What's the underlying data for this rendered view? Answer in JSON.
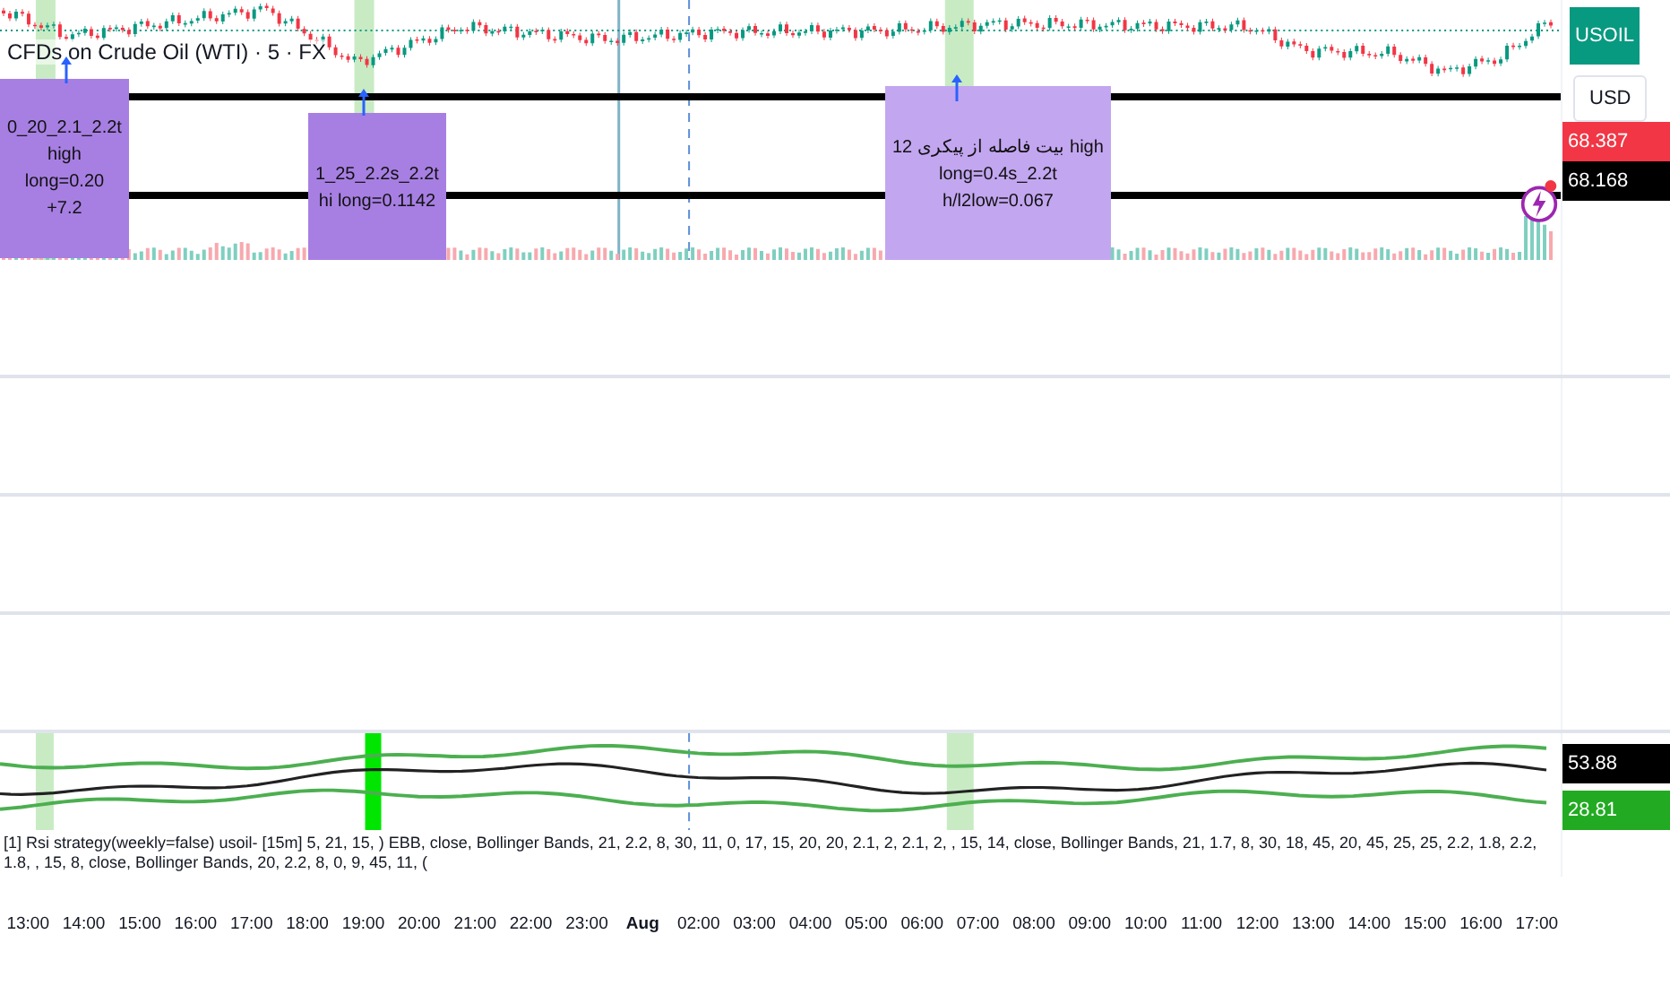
{
  "symbol_title": "CFDs on Crude Oil (WTI) · 5 · FX",
  "signal_labels": [
    {
      "lines": [
        "0_20_2.1_2.2t",
        "high",
        "long=0.20",
        "+7.2"
      ]
    },
    {
      "lines": [
        "1_25_2.2s_2.2t",
        "hi long=0.1142"
      ]
    },
    {
      "lines": [
        "بیت فاصله از پیکری 12 high",
        "long=0.4s_2.2t",
        "h/l2low=0.067"
      ]
    }
  ],
  "price_axis": {
    "symbol_tag": "USOIL",
    "currency": "USD",
    "price_tags": [
      {
        "text": "68.387",
        "color": "#f23645"
      },
      {
        "text": "68.168",
        "color": "#000000"
      }
    ]
  },
  "indicator": {
    "legend": "[1] Rsi strategy(weekly=false) usoil- [15m] 5, 21, 15, ) EBB, close, Bollinger Bands, 21, 2.2, 8, 30, 11, 0, 17, 15, 20, 20, 2.1, 2, 2.1, 2, , 15, 14, close, Bollinger Bands, 21, 1.7, 8, 30, 18, 45, 20, 45, 25, 25, 2.2, 1.8, 2.2, 1.8, , 15, 8, close, Bollinger Bands, 20, 2.2, 8, 0, 9, 45, 11, (",
    "value_tags": [
      {
        "text": "53.88",
        "color": "#000000"
      },
      {
        "text": "28.81",
        "color": "#22ab22"
      }
    ]
  },
  "time_axis": [
    {
      "label": "13:00",
      "bold": false
    },
    {
      "label": "14:00",
      "bold": false
    },
    {
      "label": "15:00",
      "bold": false
    },
    {
      "label": "16:00",
      "bold": false
    },
    {
      "label": "17:00",
      "bold": false
    },
    {
      "label": "18:00",
      "bold": false
    },
    {
      "label": "19:00",
      "bold": false
    },
    {
      "label": "20:00",
      "bold": false
    },
    {
      "label": "21:00",
      "bold": false
    },
    {
      "label": "22:00",
      "bold": false
    },
    {
      "label": "23:00",
      "bold": false
    },
    {
      "label": "Aug",
      "bold": true
    },
    {
      "label": "02:00",
      "bold": false
    },
    {
      "label": "03:00",
      "bold": false
    },
    {
      "label": "04:00",
      "bold": false
    },
    {
      "label": "05:00",
      "bold": false
    },
    {
      "label": "06:00",
      "bold": false
    },
    {
      "label": "07:00",
      "bold": false
    },
    {
      "label": "08:00",
      "bold": false
    },
    {
      "label": "09:00",
      "bold": false
    },
    {
      "label": "10:00",
      "bold": false
    },
    {
      "label": "11:00",
      "bold": false
    },
    {
      "label": "12:00",
      "bold": false
    },
    {
      "label": "13:00",
      "bold": false
    },
    {
      "label": "14:00",
      "bold": false
    },
    {
      "label": "15:00",
      "bold": false
    },
    {
      "label": "16:00",
      "bold": false
    },
    {
      "label": "17:00",
      "bold": false
    }
  ]
}
